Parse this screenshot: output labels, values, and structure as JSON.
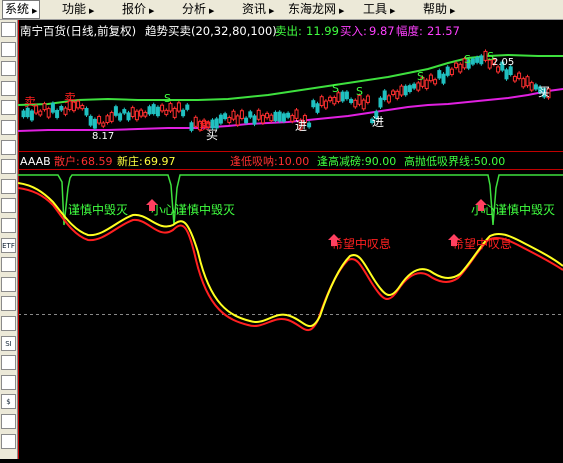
{
  "menu": {
    "items": [
      "系统",
      "功能",
      "报价",
      "分析",
      "资讯",
      "东海龙网",
      "工具",
      "帮助"
    ],
    "active_index": 0,
    "dropdown_glyph": "▶"
  },
  "toolbar": {
    "buttons": [
      {
        "icon": "monitor-icon",
        "text": ""
      },
      {
        "icon": "grid-icon",
        "text": ""
      },
      {
        "icon": "table-icon",
        "text": ""
      },
      {
        "icon": "line-chart-icon",
        "text": ""
      },
      {
        "icon": "grid-icon",
        "text": ""
      },
      {
        "icon": "table-icon",
        "text": ""
      },
      {
        "icon": "grid-icon",
        "text": ""
      },
      {
        "icon": "bar-chart-icon",
        "text": ""
      },
      {
        "icon": "pie-chart-icon",
        "text": ""
      },
      {
        "icon": "compass-icon",
        "text": ""
      },
      {
        "icon": "scale-icon",
        "text": ""
      },
      {
        "icon": "etf-icon",
        "text": "ETF"
      },
      {
        "icon": "chart-icon",
        "text": ""
      },
      {
        "icon": "monitor-icon",
        "text": ""
      },
      {
        "icon": "wave-icon",
        "text": ""
      },
      {
        "icon": "table-icon",
        "text": ""
      },
      {
        "icon": "si-icon",
        "text": "SI"
      },
      {
        "icon": "grid-icon",
        "text": ""
      },
      {
        "icon": "grid-icon",
        "text": ""
      },
      {
        "icon": "dollar-icon",
        "text": "$"
      },
      {
        "icon": "tools-icon",
        "text": ""
      },
      {
        "icon": "phone-icon",
        "text": ""
      }
    ]
  },
  "main_chart": {
    "title": "南宁百货(日线,前复权)",
    "indicator": "趋势买卖(20,32,80,100)",
    "sell_label": "卖出:",
    "sell_value": "11.99",
    "buy_label": "买入:",
    "buy_value": "9.87",
    "range_label": "幅度:",
    "range_value": "21.57",
    "annotations": [
      {
        "text": "2.05",
        "color": "#ffffff",
        "kind": "high-price"
      },
      {
        "text": "8.17",
        "color": "#ffffff",
        "kind": "low-price"
      },
      {
        "text": "卖",
        "color": "#ff2020",
        "kind": "sell-signal"
      },
      {
        "text": "卖",
        "color": "#ff2020",
        "kind": "sell-signal"
      },
      {
        "text": "卖",
        "color": "#ff2020",
        "kind": "sell-signal"
      },
      {
        "text": "S",
        "color": "#40ff40",
        "kind": "s-signal"
      },
      {
        "text": "S",
        "color": "#40ff40",
        "kind": "s-signal"
      },
      {
        "text": "S",
        "color": "#40ff40",
        "kind": "s-signal"
      },
      {
        "text": "S",
        "color": "#40ff40",
        "kind": "s-signal"
      },
      {
        "text": "S",
        "color": "#40ff40",
        "kind": "s-signal"
      },
      {
        "text": "S",
        "color": "#40ff40",
        "kind": "s-signal"
      },
      {
        "text": "买",
        "color": "#ffffff",
        "kind": "buy-signal"
      },
      {
        "text": "买",
        "color": "#ffffff",
        "kind": "buy-signal"
      },
      {
        "text": "进",
        "color": "#ffffff",
        "kind": "enter-signal"
      },
      {
        "text": "进",
        "color": "#ffffff",
        "kind": "enter-signal"
      }
    ]
  },
  "sub_chart": {
    "name": "AAAB",
    "retail_label": "散户:",
    "retail_value": "68.59",
    "new_label": "新庄:",
    "new_value": "69.97",
    "p1": "逢低吸呐:10.00",
    "p2": "逢高减磅:90.00",
    "p3": "高抛低吸界线:50.00",
    "annotations": [
      {
        "text": "谨慎中毁灭",
        "color": "#40ff40",
        "kind": "caution"
      },
      {
        "text": "小心谨慎中毁灭",
        "color": "#40ff40",
        "kind": "caution"
      },
      {
        "text": "小心谨慎中毁灭",
        "color": "#40ff40",
        "kind": "caution"
      },
      {
        "text": "希望中叹息",
        "color": "#ff2020",
        "kind": "hope"
      },
      {
        "text": "希望中叹息",
        "color": "#ff2020",
        "kind": "hope"
      }
    ]
  },
  "colors": {
    "green_line": "#3ee03e",
    "magenta_line": "#e020e0",
    "red_line": "#ff2020",
    "yellow_line": "#ffff20",
    "up_candle": "#ff3030",
    "down_candle": "#20c0c0"
  }
}
